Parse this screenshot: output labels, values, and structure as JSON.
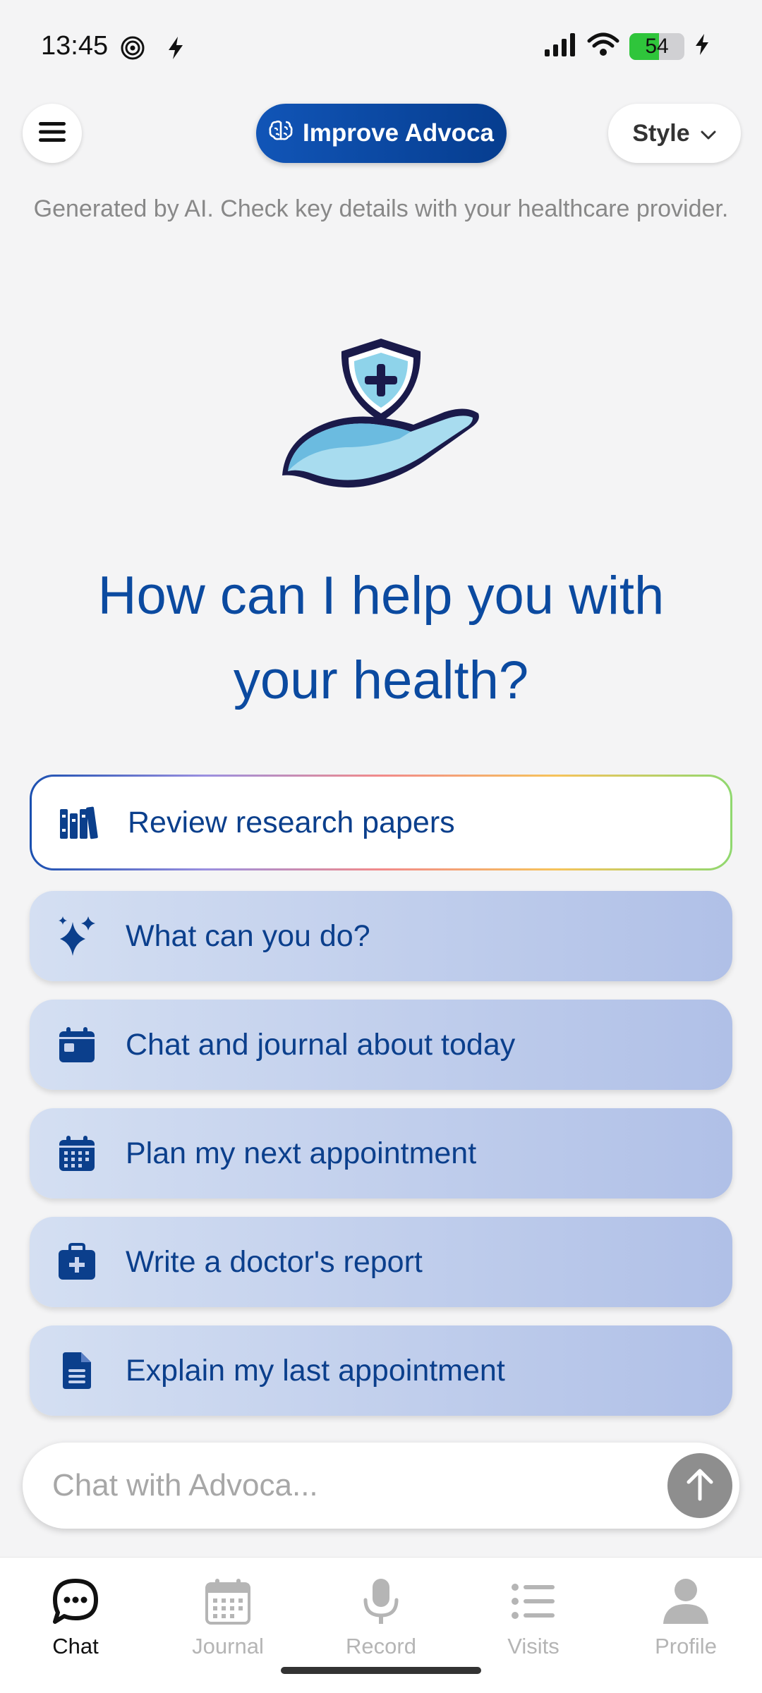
{
  "status_bar": {
    "time": "13:45",
    "battery_percent": 54,
    "battery_label": "54"
  },
  "header": {
    "improve_label": "Improve Advoca",
    "style_label": "Style",
    "disclaimer": "Generated by AI. Check key details with your healthcare provider."
  },
  "main": {
    "headline_line1": "How can I help you with",
    "headline_line2": "your health?",
    "primary_suggestion": {
      "label": "Review research papers",
      "icon": "books-icon"
    },
    "suggestions": [
      {
        "label": "What can you do?",
        "icon": "sparkles-icon"
      },
      {
        "label": "Chat and journal about today",
        "icon": "calendar-day-icon"
      },
      {
        "label": "Plan my next appointment",
        "icon": "calendar-grid-icon"
      },
      {
        "label": "Write a doctor's report",
        "icon": "medical-bag-icon"
      },
      {
        "label": "Explain my last appointment",
        "icon": "document-icon"
      }
    ]
  },
  "chat_input": {
    "placeholder": "Chat with Advoca..."
  },
  "nav": {
    "items": [
      {
        "label": "Chat",
        "icon": "chat-bubble-icon",
        "active": true
      },
      {
        "label": "Journal",
        "icon": "journal-calendar-icon",
        "active": false
      },
      {
        "label": "Record",
        "icon": "microphone-icon",
        "active": false
      },
      {
        "label": "Visits",
        "icon": "list-icon",
        "active": false
      },
      {
        "label": "Profile",
        "icon": "person-icon",
        "active": false
      }
    ]
  },
  "colors": {
    "brand_blue": "#0b4aa0",
    "suggestion_text": "#0b3f8c",
    "battery_green": "#2fc53b"
  }
}
